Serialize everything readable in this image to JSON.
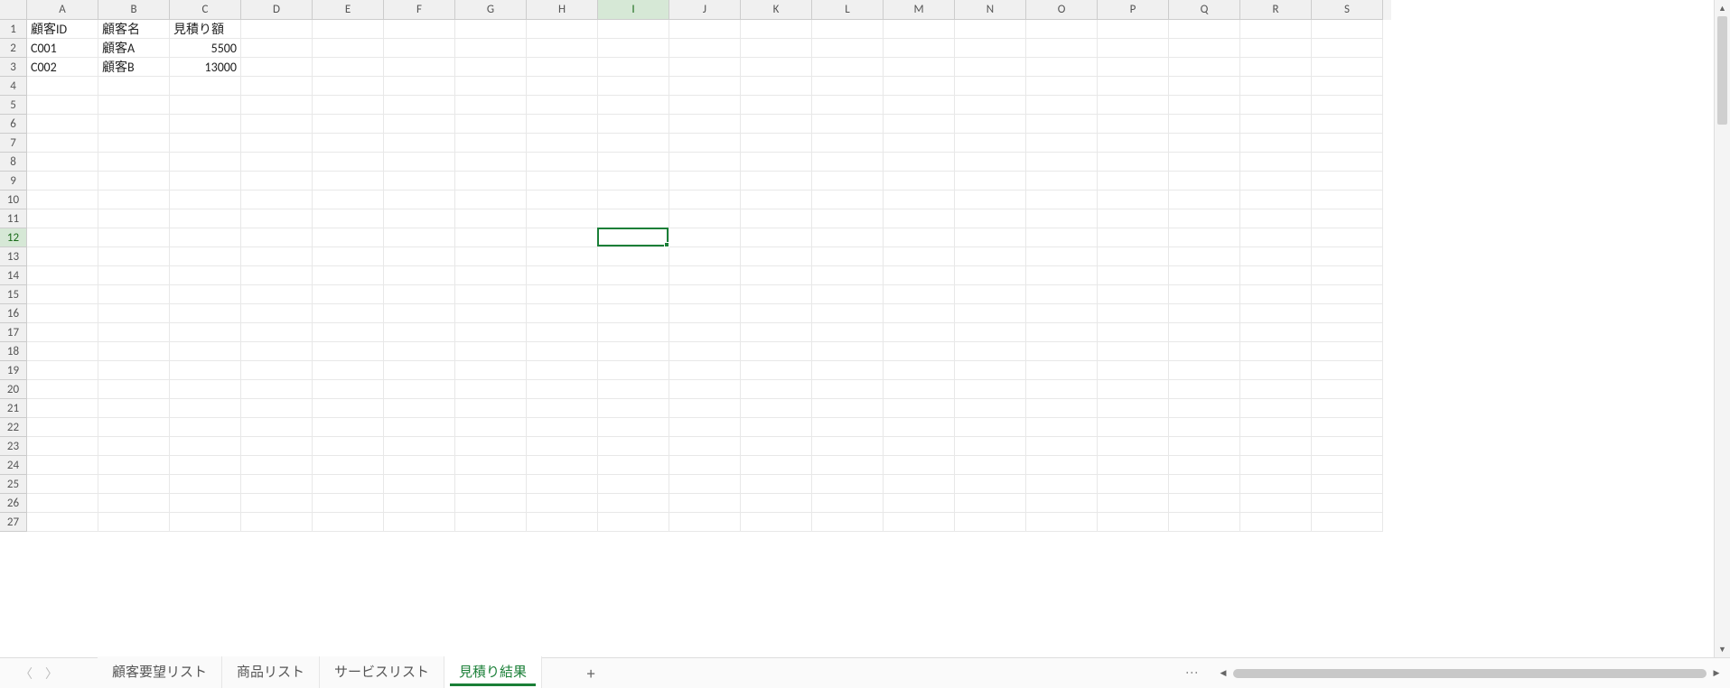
{
  "columns": [
    "A",
    "B",
    "C",
    "D",
    "E",
    "F",
    "G",
    "H",
    "I",
    "J",
    "K",
    "L",
    "M",
    "N",
    "O",
    "P",
    "Q",
    "R",
    "S"
  ],
  "row_count": 27,
  "active_cell": {
    "col_index": 8,
    "row_index": 11
  },
  "cells": {
    "A1": {
      "v": "顧客ID",
      "align": "left"
    },
    "B1": {
      "v": "顧客名",
      "align": "left"
    },
    "C1": {
      "v": "見積り額",
      "align": "left"
    },
    "A2": {
      "v": "C001",
      "align": "left"
    },
    "B2": {
      "v": "顧客A",
      "align": "left"
    },
    "C2": {
      "v": "5500",
      "align": "right"
    },
    "A3": {
      "v": "C002",
      "align": "left"
    },
    "B3": {
      "v": "顧客B",
      "align": "left"
    },
    "C3": {
      "v": "13000",
      "align": "right"
    }
  },
  "tabs": [
    {
      "label": "顧客要望リスト",
      "active": false
    },
    {
      "label": "商品リスト",
      "active": false
    },
    {
      "label": "サービスリスト",
      "active": false
    },
    {
      "label": "見積り結果",
      "active": true
    }
  ],
  "add_sheet_label": "+",
  "tab_options_glyph": "⋮"
}
